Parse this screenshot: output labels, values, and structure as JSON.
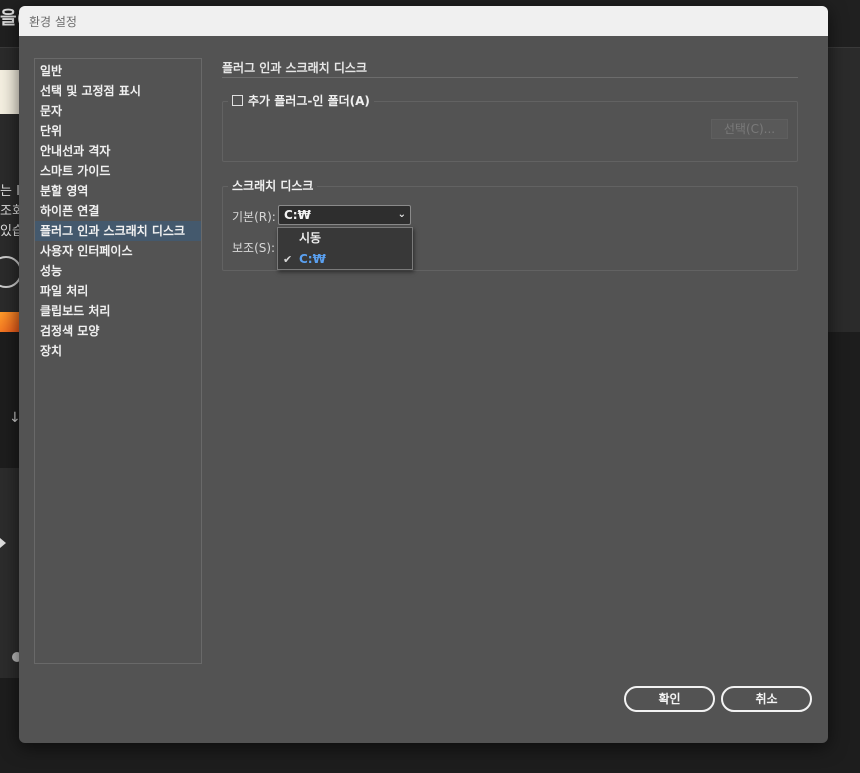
{
  "background": {
    "title_fragment": "을(",
    "text_fragments": [
      "는 Il",
      "조회",
      "있습"
    ]
  },
  "dialog": {
    "title": "환경 설정",
    "sidebar": {
      "items": [
        {
          "label": "일반",
          "selected": false
        },
        {
          "label": "선택 및 고정점 표시",
          "selected": false
        },
        {
          "label": "문자",
          "selected": false
        },
        {
          "label": "단위",
          "selected": false
        },
        {
          "label": "안내선과 격자",
          "selected": false
        },
        {
          "label": "스마트 가이드",
          "selected": false
        },
        {
          "label": "분할 영역",
          "selected": false
        },
        {
          "label": "하이픈 연결",
          "selected": false
        },
        {
          "label": "플러그 인과 스크래치 디스크",
          "selected": true
        },
        {
          "label": "사용자 인터페이스",
          "selected": false
        },
        {
          "label": "성능",
          "selected": false
        },
        {
          "label": "파일 처리",
          "selected": false
        },
        {
          "label": "클립보드 처리",
          "selected": false
        },
        {
          "label": "검정색 모양",
          "selected": false
        },
        {
          "label": "장치",
          "selected": false
        }
      ]
    },
    "panel": {
      "section_title": "플러그 인과 스크래치 디스크",
      "plugins": {
        "checkbox_label": "추가 플러그-인 폴더(A)",
        "checked": false,
        "choose_button": "선택(C)..."
      },
      "scratch": {
        "group_label": "스크래치 디스크",
        "primary_label": "기본(R):",
        "primary_value": "C:₩",
        "secondary_label": "보조(S):",
        "dropdown_options": [
          {
            "label": "시동",
            "checked": false
          },
          {
            "label": "C:₩",
            "checked": true
          }
        ]
      }
    },
    "buttons": {
      "ok": "확인",
      "cancel": "취소"
    }
  }
}
